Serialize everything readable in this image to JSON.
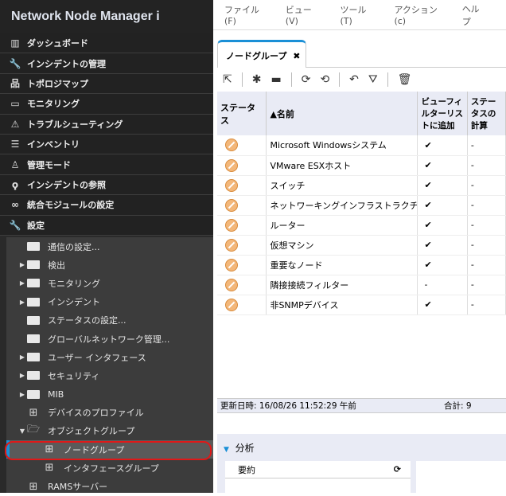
{
  "app": {
    "title": "Network Node Manager i"
  },
  "nav": [
    {
      "label": "ダッシュボード",
      "icon": "bar-chart-icon"
    },
    {
      "label": "インシデントの管理",
      "icon": "wrench-icon"
    },
    {
      "label": "トポロジマップ",
      "icon": "hierarchy-icon"
    },
    {
      "label": "モニタリング",
      "icon": "monitor-icon"
    },
    {
      "label": "トラブルシューティング",
      "icon": "warning-icon"
    },
    {
      "label": "インベントリ",
      "icon": "server-icon"
    },
    {
      "label": "管理モード",
      "icon": "user-icon"
    },
    {
      "label": "インシデントの参照",
      "icon": "search-user-icon"
    },
    {
      "label": "統合モジュールの設定",
      "icon": "link-icon"
    },
    {
      "label": "設定",
      "icon": "wrench-icon"
    }
  ],
  "tree": [
    {
      "label": "通信の設定..."
    },
    {
      "label": "検出"
    },
    {
      "label": "モニタリング"
    },
    {
      "label": "インシデント"
    },
    {
      "label": "ステータスの設定..."
    },
    {
      "label": "グローバルネットワーク管理..."
    },
    {
      "label": "ユーザー インタフェース"
    },
    {
      "label": "セキュリティ"
    },
    {
      "label": "MIB"
    },
    {
      "label": "デバイスのプロファイル"
    },
    {
      "label": "オブジェクトグループ"
    },
    {
      "label": "ノードグループ"
    },
    {
      "label": "インタフェースグループ"
    },
    {
      "label": "RAMSサーバー"
    }
  ],
  "menu": [
    "ファイル(F)",
    "ビュー(V)",
    "ツール(T)",
    "アクション(c)",
    "ヘルプ"
  ],
  "tab": {
    "label": "ノードグループ",
    "close": "✖"
  },
  "table": {
    "headers": [
      "ステータス",
      "▲名前",
      "ビューフィルターリストに追加",
      "ステータスの計算"
    ],
    "rows": [
      {
        "name": "Microsoft Windowsシステム",
        "filter": "✔",
        "calc": "-"
      },
      {
        "name": "VMware ESXホスト",
        "filter": "✔",
        "calc": "-"
      },
      {
        "name": "スイッチ",
        "filter": "✔",
        "calc": "-"
      },
      {
        "name": "ネットワーキングインフラストラクチャデバイス",
        "filter": "✔",
        "calc": "-"
      },
      {
        "name": "ルーター",
        "filter": "✔",
        "calc": "-"
      },
      {
        "name": "仮想マシン",
        "filter": "✔",
        "calc": "-"
      },
      {
        "name": "重要なノード",
        "filter": "✔",
        "calc": "-"
      },
      {
        "name": "隣接接続フィルター",
        "filter": "-",
        "calc": "-"
      },
      {
        "name": "非SNMPデバイス",
        "filter": "✔",
        "calc": "-"
      }
    ]
  },
  "status": {
    "updated": "更新日時: 16/08/26 11:52:29 午前",
    "total": "合計: 9"
  },
  "analysis": {
    "title": "分析",
    "summary": "要約"
  },
  "colors": {
    "accent": "#1a8fd6",
    "highlight": "#e01818",
    "status": "#f3b77a"
  }
}
